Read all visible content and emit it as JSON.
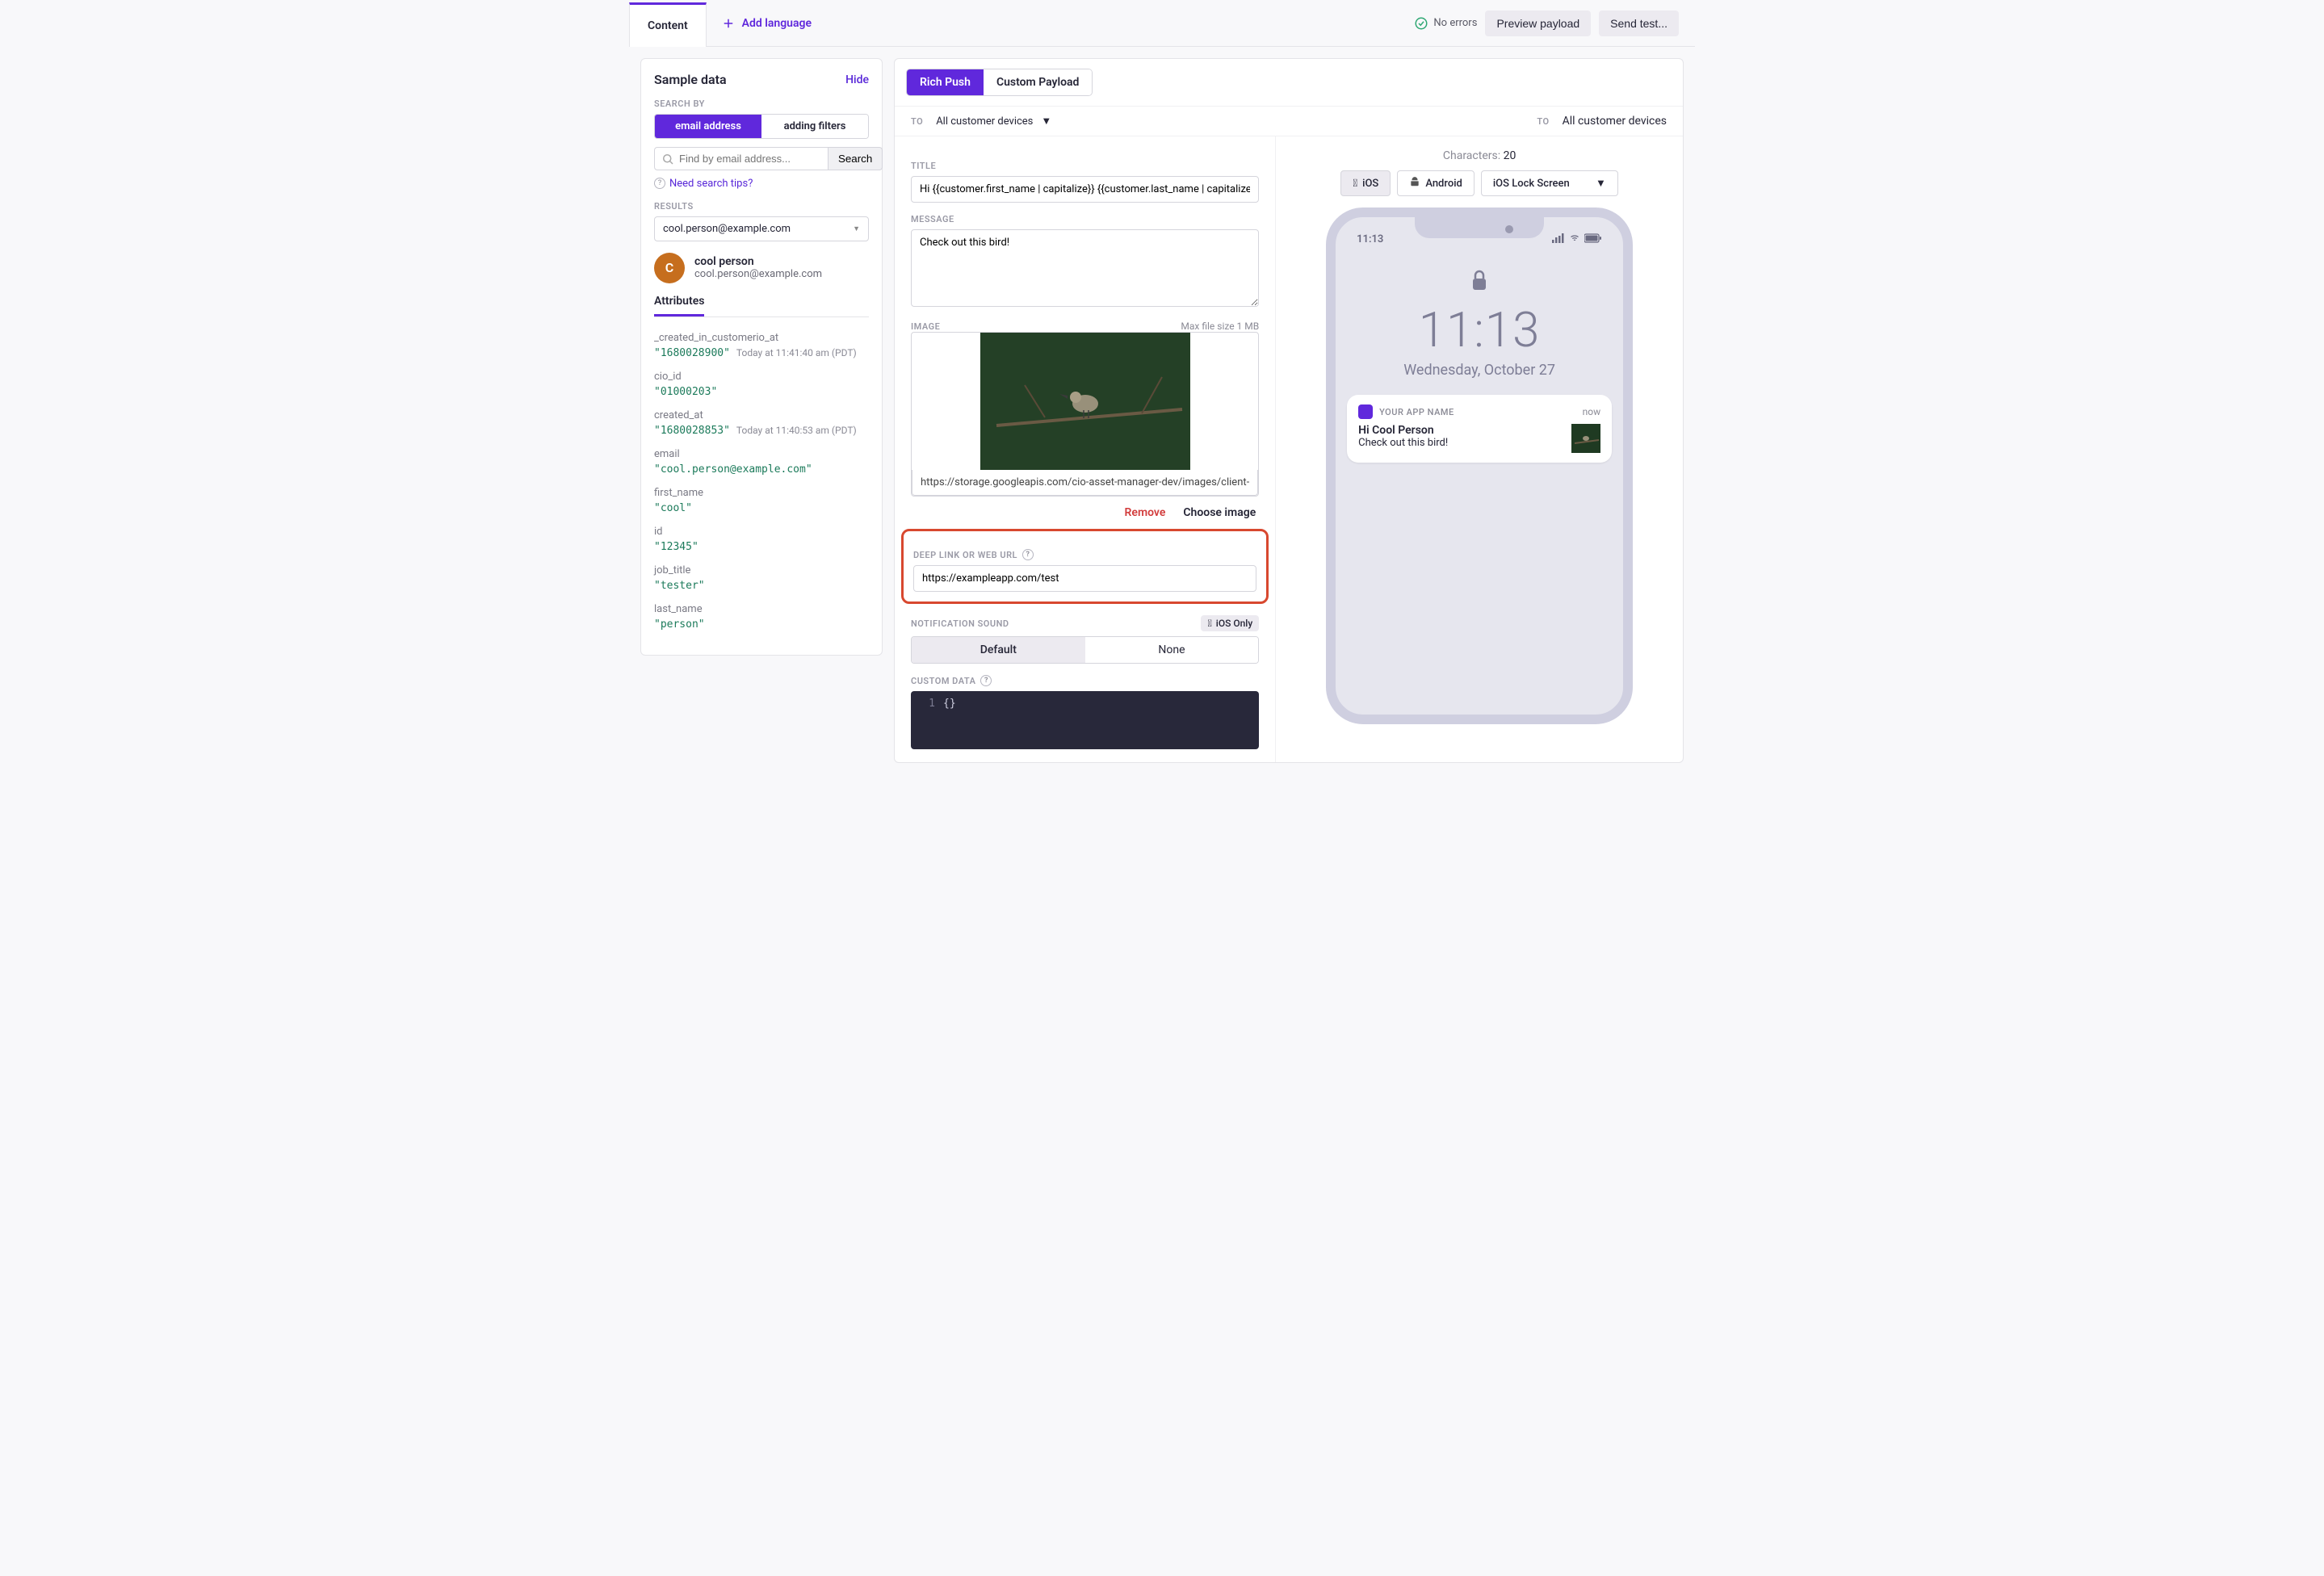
{
  "topbar": {
    "content_tab": "Content",
    "add_language": "Add language",
    "no_errors": "No errors",
    "preview_payload": "Preview payload",
    "send_test": "Send test..."
  },
  "sidebar": {
    "title": "Sample data",
    "hide": "Hide",
    "search_by_label": "SEARCH BY",
    "search_by_options": {
      "email": "email address",
      "filters": "adding filters"
    },
    "search_placeholder": "Find by email address...",
    "search_button": "Search",
    "tips": "Need search tips?",
    "results_label": "RESULTS",
    "results_selected": "cool.person@example.com",
    "person": {
      "initial": "C",
      "name": "cool person",
      "email": "cool.person@example.com"
    },
    "attributes_tab": "Attributes",
    "attributes": [
      {
        "key": "_created_in_customerio_at",
        "value": "\"1680028900\"",
        "meta": "Today at 11:41:40 am (PDT)"
      },
      {
        "key": "cio_id",
        "value": "\"01000203\"",
        "meta": ""
      },
      {
        "key": "created_at",
        "value": "\"1680028853\"",
        "meta": "Today at 11:40:53 am (PDT)"
      },
      {
        "key": "email",
        "value": "\"cool.person@example.com\"",
        "meta": ""
      },
      {
        "key": "first_name",
        "value": "\"cool\"",
        "meta": ""
      },
      {
        "key": "id",
        "value": "\"12345\"",
        "meta": ""
      },
      {
        "key": "job_title",
        "value": "\"tester\"",
        "meta": ""
      },
      {
        "key": "last_name",
        "value": "\"person\"",
        "meta": ""
      }
    ]
  },
  "editor": {
    "tabs": {
      "rich": "Rich Push",
      "custom": "Custom Payload"
    },
    "to_label": "TO",
    "to_value": "All customer devices",
    "title_label": "TITLE",
    "title_value": "Hi {{customer.first_name | capitalize}} {{customer.last_name | capitalize}}",
    "message_label": "MESSAGE",
    "message_value": "Check out this bird!",
    "image_label": "IMAGE",
    "image_info": "Max file size 1 MB",
    "image_url": "https://storage.googleapis.com/cio-asset-manager-dev/images/client-",
    "remove": "Remove",
    "choose": "Choose image",
    "deep_link_label": "DEEP LINK OR WEB URL",
    "deep_link_value": "https://exampleapp.com/test",
    "sound_label": "NOTIFICATION SOUND",
    "ios_only": "iOS Only",
    "sound_options": {
      "default": "Default",
      "none": "None"
    },
    "custom_data_label": "CUSTOM DATA",
    "custom_data_line_no": "1",
    "custom_data_code": "{}"
  },
  "preview": {
    "to_label": "TO",
    "to_value": "All customer devices",
    "characters_label": "Characters",
    "characters_value": "20",
    "device_tabs": {
      "ios": "iOS",
      "android": "Android"
    },
    "view_select": "iOS Lock Screen",
    "status_time": "11:13",
    "big_time": "11:13",
    "date": "Wednesday, October 27",
    "notif": {
      "app": "YOUR APP NAME",
      "when": "now",
      "title": "Hi Cool Person",
      "message": "Check out this bird!"
    }
  }
}
